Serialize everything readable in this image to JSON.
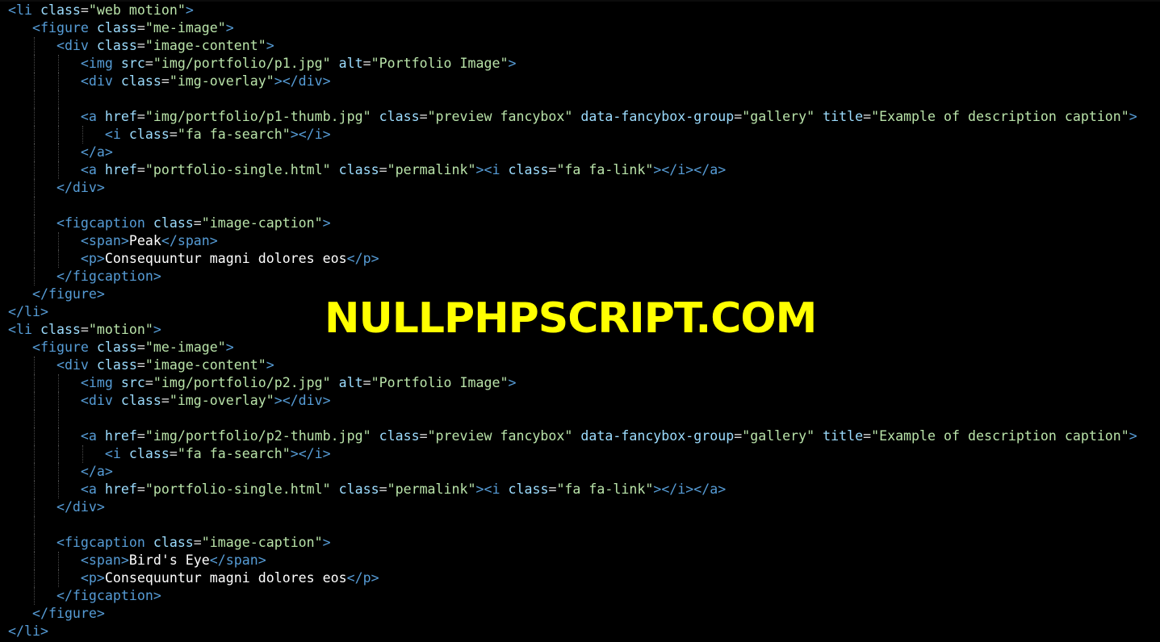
{
  "editor": {
    "background": "#000000",
    "colors": {
      "tag": "#569cd6",
      "attribute": "#9cdcfe",
      "string": "#b9e3a9",
      "text": "#ffffff",
      "watermark": "#ffff00"
    }
  },
  "watermark": {
    "text": "NULLPHPSCRIPT.COM"
  },
  "code_lines": [
    {
      "indent": 0,
      "tokens": [
        [
          "tag",
          "<li "
        ],
        [
          "attr",
          "class"
        ],
        [
          "eq",
          "="
        ],
        [
          "str",
          "\"web motion\""
        ],
        [
          "tag",
          ">"
        ]
      ]
    },
    {
      "indent": 1,
      "tokens": [
        [
          "tag",
          "<figure "
        ],
        [
          "attr",
          "class"
        ],
        [
          "eq",
          "="
        ],
        [
          "str",
          "\"me-image\""
        ],
        [
          "tag",
          ">"
        ]
      ]
    },
    {
      "indent": 2,
      "tokens": [
        [
          "tag",
          "<div "
        ],
        [
          "attr",
          "class"
        ],
        [
          "eq",
          "="
        ],
        [
          "str",
          "\"image-content\""
        ],
        [
          "tag",
          ">"
        ]
      ]
    },
    {
      "indent": 3,
      "tokens": [
        [
          "tag",
          "<img "
        ],
        [
          "attr",
          "src"
        ],
        [
          "eq",
          "="
        ],
        [
          "str",
          "\"img/portfolio/p1.jpg\""
        ],
        [
          "txt",
          " "
        ],
        [
          "attr",
          "alt"
        ],
        [
          "eq",
          "="
        ],
        [
          "str",
          "\"Portfolio Image\""
        ],
        [
          "tag",
          ">"
        ]
      ]
    },
    {
      "indent": 3,
      "tokens": [
        [
          "tag",
          "<div "
        ],
        [
          "attr",
          "class"
        ],
        [
          "eq",
          "="
        ],
        [
          "str",
          "\"img-overlay\""
        ],
        [
          "tag",
          "></div>"
        ]
      ]
    },
    {
      "indent": 3,
      "tokens": []
    },
    {
      "indent": 3,
      "tokens": [
        [
          "tag",
          "<a "
        ],
        [
          "attr",
          "href"
        ],
        [
          "eq",
          "="
        ],
        [
          "str",
          "\"img/portfolio/p1-thumb.jpg\""
        ],
        [
          "txt",
          " "
        ],
        [
          "attr",
          "class"
        ],
        [
          "eq",
          "="
        ],
        [
          "str",
          "\"preview fancybox\""
        ],
        [
          "txt",
          " "
        ],
        [
          "attr",
          "data-fancybox-group"
        ],
        [
          "eq",
          "="
        ],
        [
          "str",
          "\"gallery\""
        ],
        [
          "txt",
          " "
        ],
        [
          "attr",
          "title"
        ],
        [
          "eq",
          "="
        ],
        [
          "str",
          "\"Example of description caption\""
        ],
        [
          "tag",
          ">"
        ]
      ]
    },
    {
      "indent": 4,
      "tokens": [
        [
          "tag",
          "<i "
        ],
        [
          "attr",
          "class"
        ],
        [
          "eq",
          "="
        ],
        [
          "str",
          "\"fa fa-search\""
        ],
        [
          "tag",
          "></i>"
        ]
      ]
    },
    {
      "indent": 3,
      "tokens": [
        [
          "tag",
          "</a>"
        ]
      ]
    },
    {
      "indent": 3,
      "tokens": [
        [
          "tag",
          "<a "
        ],
        [
          "attr",
          "href"
        ],
        [
          "eq",
          "="
        ],
        [
          "str",
          "\"portfolio-single.html\""
        ],
        [
          "txt",
          " "
        ],
        [
          "attr",
          "class"
        ],
        [
          "eq",
          "="
        ],
        [
          "str",
          "\"permalink\""
        ],
        [
          "tag",
          "><i "
        ],
        [
          "attr",
          "class"
        ],
        [
          "eq",
          "="
        ],
        [
          "str",
          "\"fa fa-link\""
        ],
        [
          "tag",
          "></i></a>"
        ]
      ]
    },
    {
      "indent": 2,
      "tokens": [
        [
          "tag",
          "</div>"
        ]
      ]
    },
    {
      "indent": 2,
      "tokens": []
    },
    {
      "indent": 2,
      "tokens": [
        [
          "tag",
          "<figcaption "
        ],
        [
          "attr",
          "class"
        ],
        [
          "eq",
          "="
        ],
        [
          "str",
          "\"image-caption\""
        ],
        [
          "tag",
          ">"
        ]
      ]
    },
    {
      "indent": 3,
      "tokens": [
        [
          "tag",
          "<span>"
        ],
        [
          "txt",
          "Peak"
        ],
        [
          "tag",
          "</span>"
        ]
      ]
    },
    {
      "indent": 3,
      "tokens": [
        [
          "tag",
          "<p>"
        ],
        [
          "txt",
          "Consequuntur magni dolores eos"
        ],
        [
          "tag",
          "</p>"
        ]
      ]
    },
    {
      "indent": 2,
      "tokens": [
        [
          "tag",
          "</figcaption>"
        ]
      ]
    },
    {
      "indent": 1,
      "tokens": [
        [
          "tag",
          "</figure>"
        ]
      ]
    },
    {
      "indent": 0,
      "tokens": [
        [
          "tag",
          "</li>"
        ]
      ]
    },
    {
      "indent": 0,
      "tokens": [
        [
          "tag",
          "<li "
        ],
        [
          "attr",
          "class"
        ],
        [
          "eq",
          "="
        ],
        [
          "str",
          "\"motion\""
        ],
        [
          "tag",
          ">"
        ]
      ]
    },
    {
      "indent": 1,
      "tokens": [
        [
          "tag",
          "<figure "
        ],
        [
          "attr",
          "class"
        ],
        [
          "eq",
          "="
        ],
        [
          "str",
          "\"me-image\""
        ],
        [
          "tag",
          ">"
        ]
      ]
    },
    {
      "indent": 2,
      "tokens": [
        [
          "tag",
          "<div "
        ],
        [
          "attr",
          "class"
        ],
        [
          "eq",
          "="
        ],
        [
          "str",
          "\"image-content\""
        ],
        [
          "tag",
          ">"
        ]
      ]
    },
    {
      "indent": 3,
      "tokens": [
        [
          "tag",
          "<img "
        ],
        [
          "attr",
          "src"
        ],
        [
          "eq",
          "="
        ],
        [
          "str",
          "\"img/portfolio/p2.jpg\""
        ],
        [
          "txt",
          " "
        ],
        [
          "attr",
          "alt"
        ],
        [
          "eq",
          "="
        ],
        [
          "str",
          "\"Portfolio Image\""
        ],
        [
          "tag",
          ">"
        ]
      ]
    },
    {
      "indent": 3,
      "tokens": [
        [
          "tag",
          "<div "
        ],
        [
          "attr",
          "class"
        ],
        [
          "eq",
          "="
        ],
        [
          "str",
          "\"img-overlay\""
        ],
        [
          "tag",
          "></div>"
        ]
      ]
    },
    {
      "indent": 3,
      "tokens": []
    },
    {
      "indent": 3,
      "tokens": [
        [
          "tag",
          "<a "
        ],
        [
          "attr",
          "href"
        ],
        [
          "eq",
          "="
        ],
        [
          "str",
          "\"img/portfolio/p2-thumb.jpg\""
        ],
        [
          "txt",
          " "
        ],
        [
          "attr",
          "class"
        ],
        [
          "eq",
          "="
        ],
        [
          "str",
          "\"preview fancybox\""
        ],
        [
          "txt",
          " "
        ],
        [
          "attr",
          "data-fancybox-group"
        ],
        [
          "eq",
          "="
        ],
        [
          "str",
          "\"gallery\""
        ],
        [
          "txt",
          " "
        ],
        [
          "attr",
          "title"
        ],
        [
          "eq",
          "="
        ],
        [
          "str",
          "\"Example of description caption\""
        ],
        [
          "tag",
          ">"
        ]
      ]
    },
    {
      "indent": 4,
      "tokens": [
        [
          "tag",
          "<i "
        ],
        [
          "attr",
          "class"
        ],
        [
          "eq",
          "="
        ],
        [
          "str",
          "\"fa fa-search\""
        ],
        [
          "tag",
          "></i>"
        ]
      ]
    },
    {
      "indent": 3,
      "tokens": [
        [
          "tag",
          "</a>"
        ]
      ]
    },
    {
      "indent": 3,
      "tokens": [
        [
          "tag",
          "<a "
        ],
        [
          "attr",
          "href"
        ],
        [
          "eq",
          "="
        ],
        [
          "str",
          "\"portfolio-single.html\""
        ],
        [
          "txt",
          " "
        ],
        [
          "attr",
          "class"
        ],
        [
          "eq",
          "="
        ],
        [
          "str",
          "\"permalink\""
        ],
        [
          "tag",
          "><i "
        ],
        [
          "attr",
          "class"
        ],
        [
          "eq",
          "="
        ],
        [
          "str",
          "\"fa fa-link\""
        ],
        [
          "tag",
          "></i></a>"
        ]
      ]
    },
    {
      "indent": 2,
      "tokens": [
        [
          "tag",
          "</div>"
        ]
      ]
    },
    {
      "indent": 2,
      "tokens": []
    },
    {
      "indent": 2,
      "tokens": [
        [
          "tag",
          "<figcaption "
        ],
        [
          "attr",
          "class"
        ],
        [
          "eq",
          "="
        ],
        [
          "str",
          "\"image-caption\""
        ],
        [
          "tag",
          ">"
        ]
      ]
    },
    {
      "indent": 3,
      "tokens": [
        [
          "tag",
          "<span>"
        ],
        [
          "txt",
          "Bird's Eye"
        ],
        [
          "tag",
          "</span>"
        ]
      ]
    },
    {
      "indent": 3,
      "tokens": [
        [
          "tag",
          "<p>"
        ],
        [
          "txt",
          "Consequuntur magni dolores eos"
        ],
        [
          "tag",
          "</p>"
        ]
      ]
    },
    {
      "indent": 2,
      "tokens": [
        [
          "tag",
          "</figcaption>"
        ]
      ]
    },
    {
      "indent": 1,
      "tokens": [
        [
          "tag",
          "</figure>"
        ]
      ]
    },
    {
      "indent": 0,
      "tokens": [
        [
          "tag",
          "</li>"
        ]
      ]
    }
  ]
}
